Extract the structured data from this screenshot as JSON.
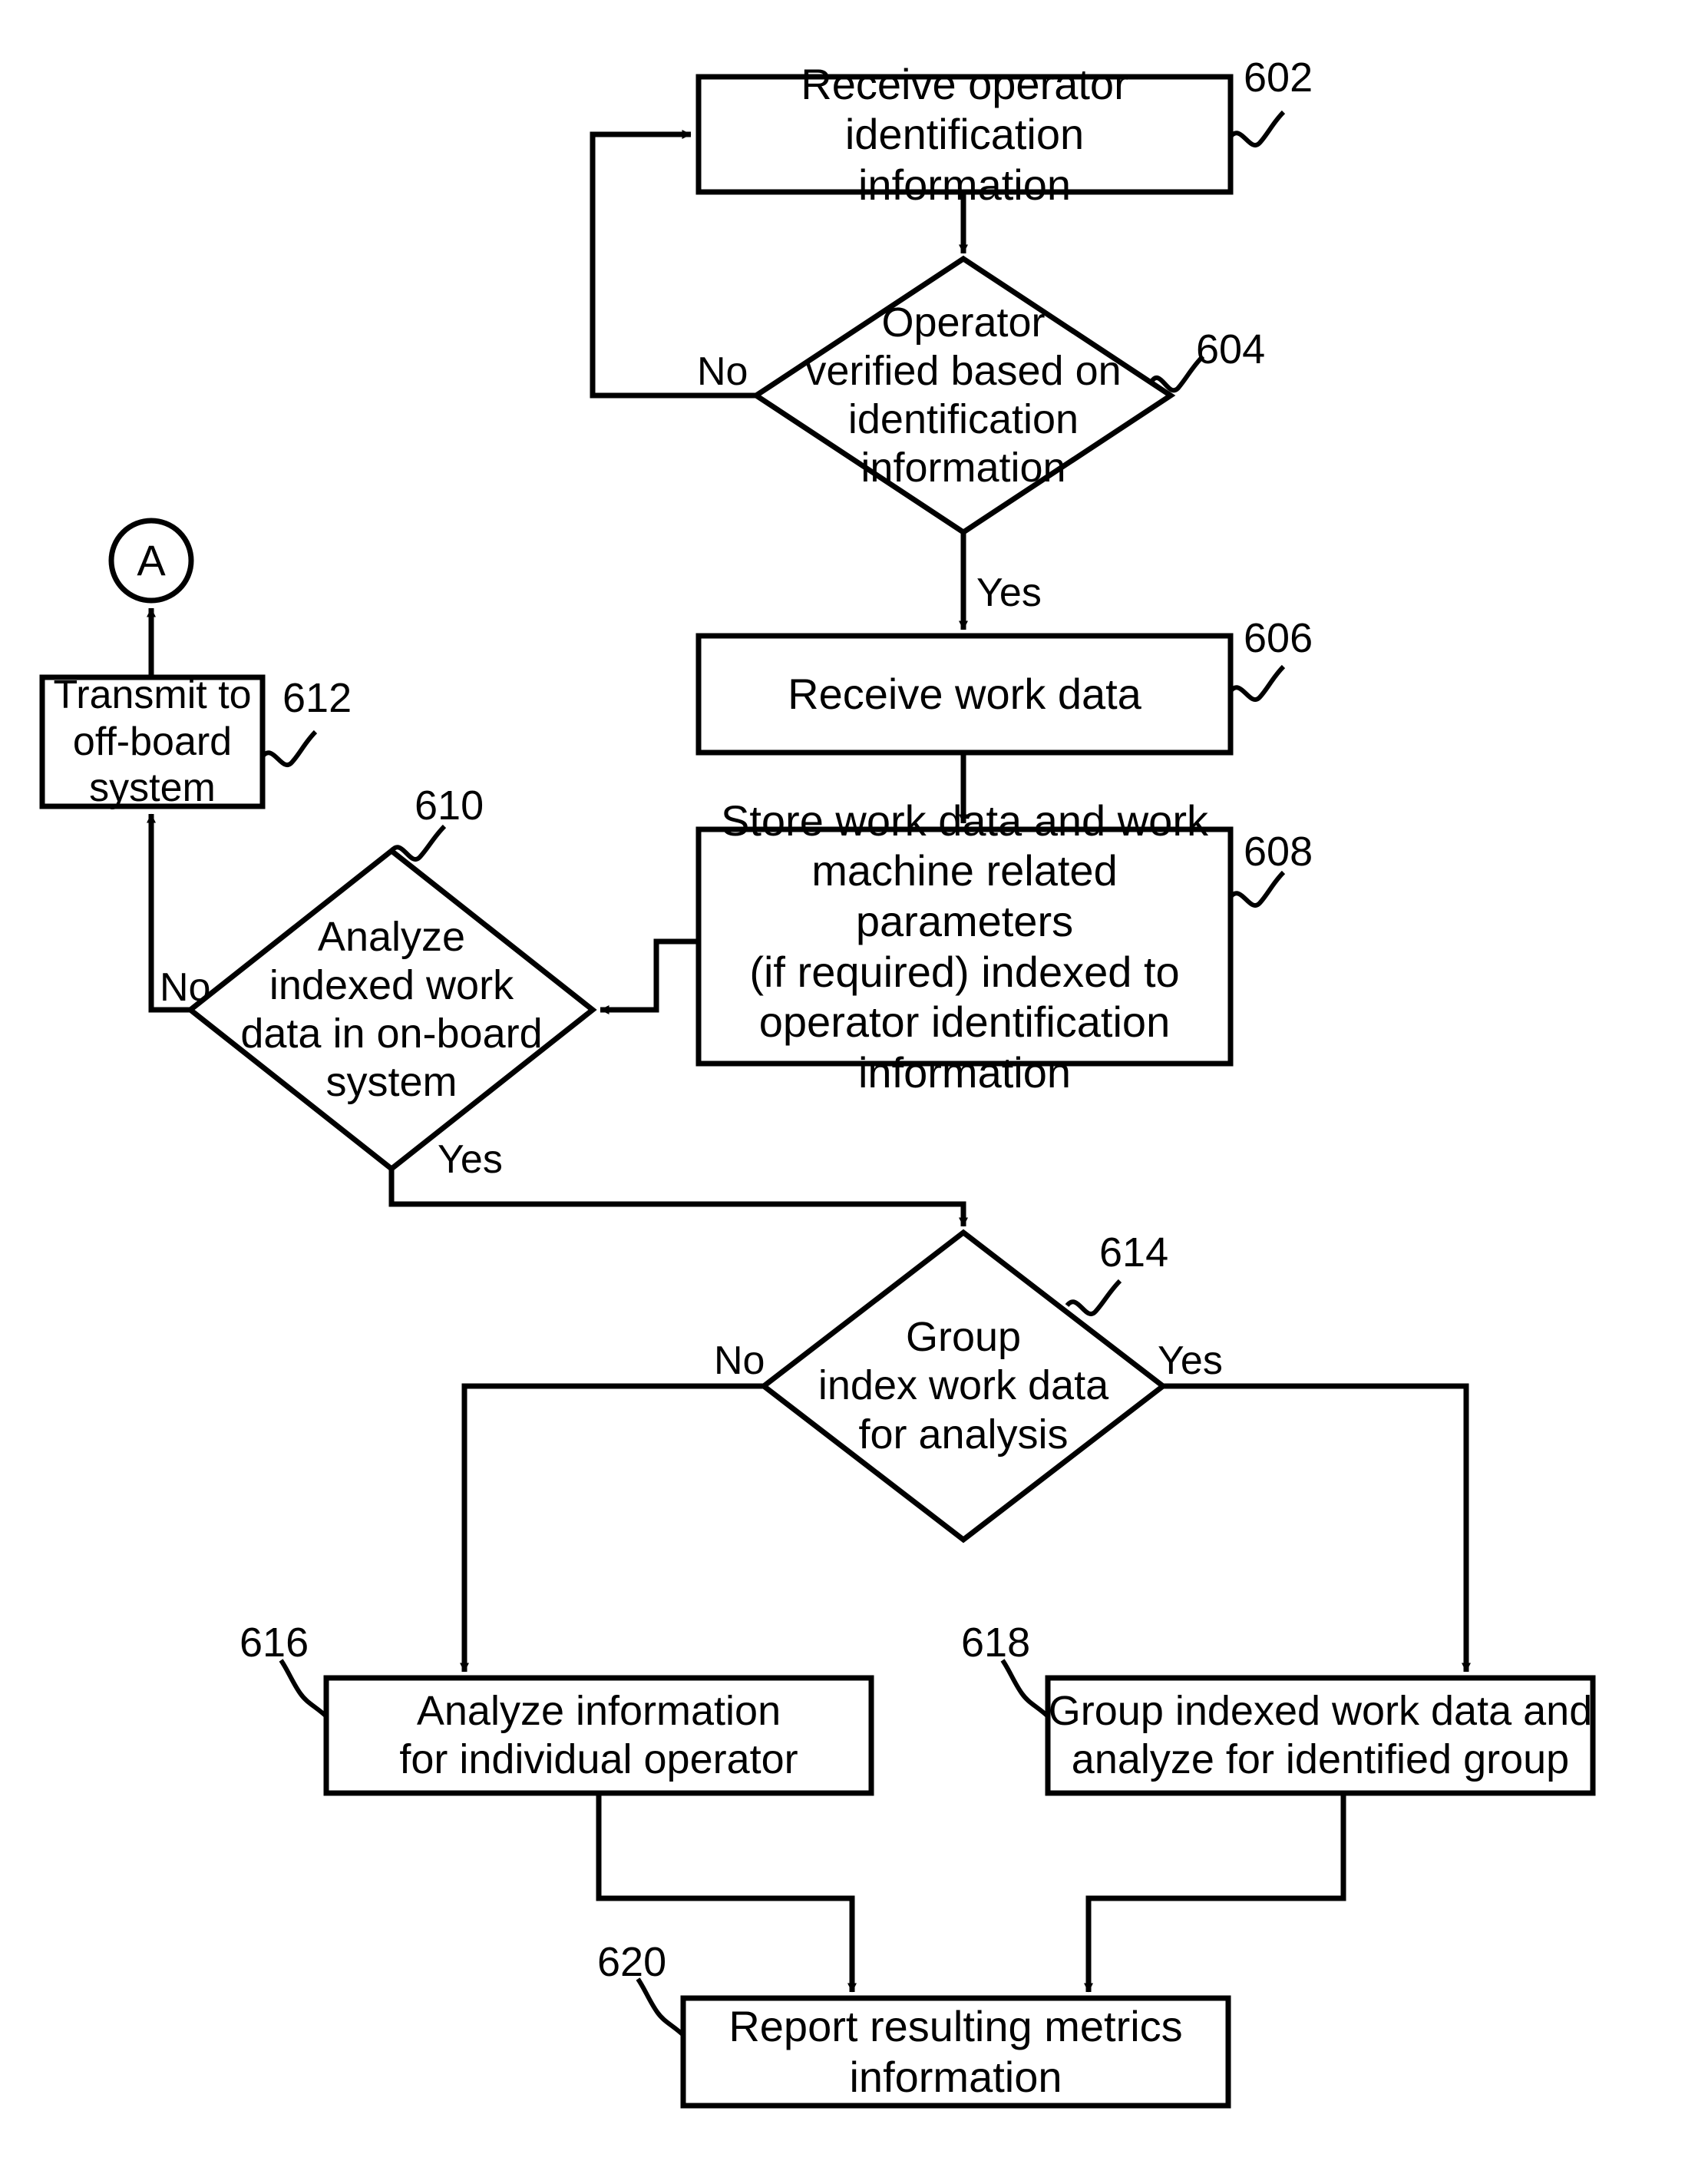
{
  "figure": {
    "type": "patent-flowchart",
    "connector_label": "A"
  },
  "nodes": [
    {
      "id": "602",
      "shape": "process",
      "ref": "602",
      "text": "Receive operator identification\ninformation"
    },
    {
      "id": "604",
      "shape": "decision",
      "ref": "604",
      "text": "Operator\nverified based on\nidentification\ninformation"
    },
    {
      "id": "606",
      "shape": "process",
      "ref": "606",
      "text": "Receive work data"
    },
    {
      "id": "608",
      "shape": "process",
      "ref": "608",
      "text": "Store work data and work\nmachine related parameters\n(if required) indexed to\noperator identification\ninformation"
    },
    {
      "id": "610",
      "shape": "decision",
      "ref": "610",
      "text": "Analyze\nindexed work\ndata in on-board\nsystem"
    },
    {
      "id": "612",
      "shape": "process",
      "ref": "612",
      "text": "Transmit to\noff-board\nsystem"
    },
    {
      "id": "614",
      "shape": "decision",
      "ref": "614",
      "text": "Group\nindex work data\nfor analysis"
    },
    {
      "id": "616",
      "shape": "process",
      "ref": "616",
      "text": "Analyze information\nfor individual operator"
    },
    {
      "id": "618",
      "shape": "process",
      "ref": "618",
      "text": "Group indexed work data and\nanalyze for identified group"
    },
    {
      "id": "620",
      "shape": "process",
      "ref": "620",
      "text": "Report resulting metrics\ninformation"
    }
  ],
  "branch_labels": {
    "d604_no": "No",
    "d604_yes": "Yes",
    "d610_no": "No",
    "d610_yes": "Yes",
    "d614_no": "No",
    "d614_yes": "Yes"
  }
}
